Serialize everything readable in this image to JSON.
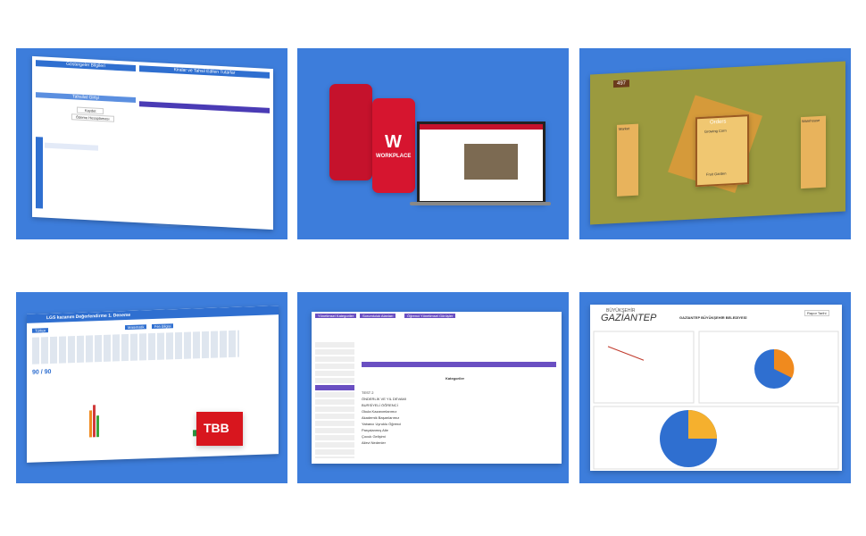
{
  "tile1": {
    "left_title": "Göstergeler Bilgileri",
    "left_section": "Tahsilat Girişi",
    "right_title": "Kiralar ve Tahsil Edilen Tutarlar",
    "button1": "Kaydet",
    "button2": "Ödeme Hesaplaması"
  },
  "tile2": {
    "phone_brand": "WORKPLACE",
    "phone_letter": "W"
  },
  "tile3": {
    "coins": "497",
    "orders_title": "Orders",
    "growing": "Growing Corn",
    "fruit": "Fruit Garden",
    "market": "Market",
    "warehouse": "Warehouse"
  },
  "tile4": {
    "title": "LGS kazanım Değerlendirme 1. Deneme",
    "tab1": "Türkçe",
    "tab2": "Matematik",
    "tab3": "Fen Bilgisi",
    "score": "90 / 90",
    "logo": "TBB",
    "submit": "Cevabı Gönder"
  },
  "tile5": {
    "tab1": "Yönetimsel Kategoriler",
    "tab2": "Sorumluluk Alanları",
    "tab3": "Öğrenci Yönetimsel Görüşler",
    "heading": "Kategoriler",
    "items": [
      "TEST 2",
      "ÖNDERLİK VE YIL DEVAMI",
      "BURSİYELİ ÖĞRENCİ",
      "Okula Kazanımlarımız",
      "Akademik Başarılarımız",
      "Yabancı Uyruklu Öğrenci",
      "Parçalanmış Aile",
      "Çocuk Gelişimi",
      "Ailevi Nedenler"
    ]
  },
  "tile6": {
    "logo_top": "BÜYÜKŞEHİR",
    "logo_main": "GAZİANTEP",
    "report_title": "GAZİANTEP BÜYÜKŞEHİR BELEDİYESİ",
    "button": "Rapor Tarihi"
  },
  "chart_data": {
    "type": "line",
    "x": [
      1,
      2,
      3
    ],
    "series": [
      {
        "values": [
          830,
          590,
          null
        ]
      }
    ],
    "ylim": [
      0,
      1000
    ]
  }
}
